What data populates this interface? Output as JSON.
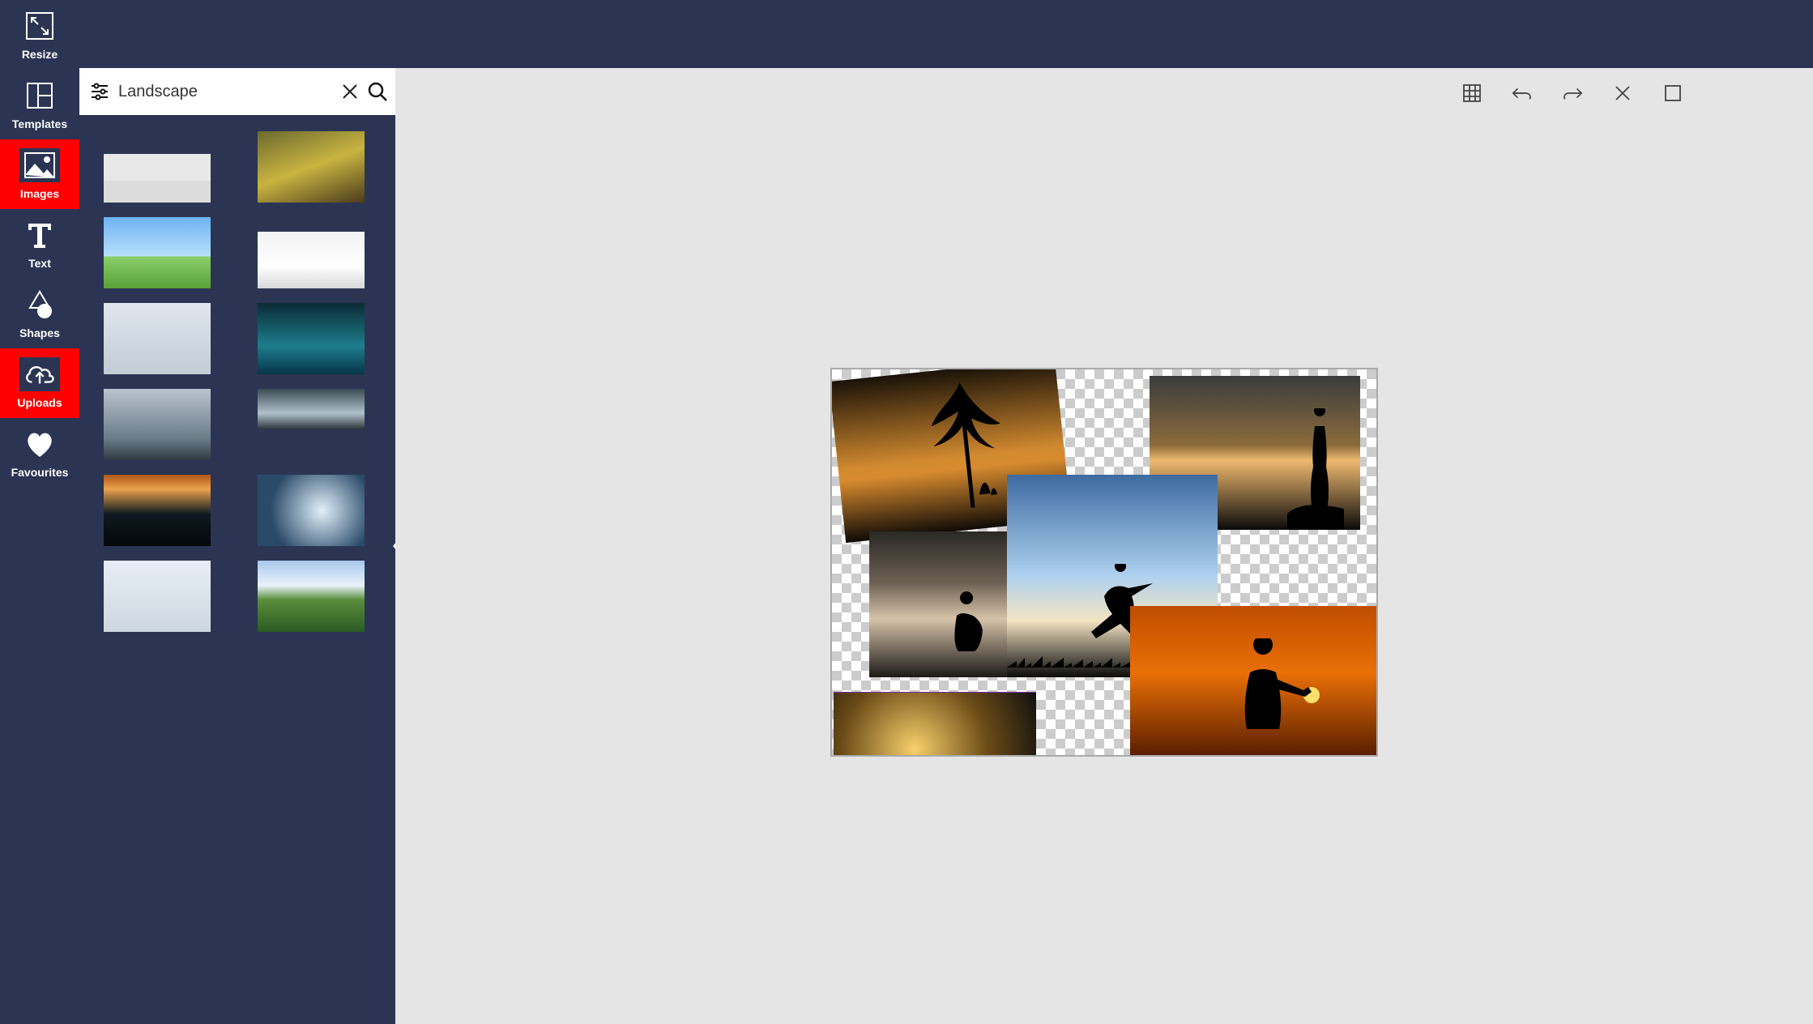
{
  "sidebar": {
    "items": [
      {
        "label": "Resize",
        "icon": "resize-icon",
        "highlighted": false
      },
      {
        "label": "Templates",
        "icon": "templates-icon",
        "highlighted": false
      },
      {
        "label": "Images",
        "icon": "images-icon",
        "highlighted": true
      },
      {
        "label": "Text",
        "icon": "text-icon",
        "highlighted": false
      },
      {
        "label": "Shapes",
        "icon": "shapes-icon",
        "highlighted": false
      },
      {
        "label": "Uploads",
        "icon": "uploads-icon",
        "highlighted": true
      },
      {
        "label": "Favourites",
        "icon": "favourites-icon",
        "highlighted": false
      }
    ]
  },
  "search": {
    "value": "Landscape",
    "placeholder": "Search"
  },
  "image_panel": {
    "thumbnails": [
      "landscape-misty-horizon",
      "landscape-autumn-forest-path",
      "landscape-green-field-blue-sky",
      "landscape-snow-dunes",
      "landscape-snow-footprints",
      "landscape-teal-mountain-lake",
      "landscape-stormy-coast-rock",
      "landscape-dark-clouds-band",
      "landscape-sunset-dark-ocean",
      "landscape-man-digital-lights",
      "landscape-winter-couple-kiss",
      "landscape-rolling-green-hills"
    ]
  },
  "canvas": {
    "toolbar": [
      "grid",
      "undo",
      "redo",
      "close",
      "fullscreen"
    ],
    "placed_images": [
      "sunset-silhouette-tree-family",
      "sunset-silhouette-person-on-rock-sea",
      "lake-pier-person-reflection",
      "silhouette-man-jumping-skyline",
      "sunset-silhouette-photographer-sun",
      "sparkler-fire-dark"
    ]
  }
}
